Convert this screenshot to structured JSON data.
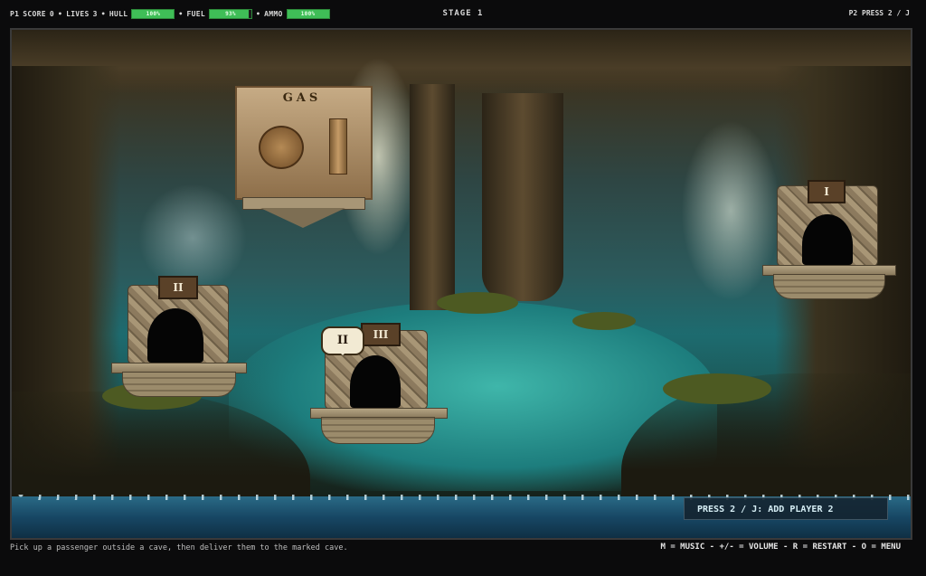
{
  "hud": {
    "p1_label": "P1",
    "score_label": "SCORE",
    "score_value": "0",
    "lives_label": "LIVES",
    "lives_value": "3",
    "hull_label": "HULL",
    "hull_pct": "100%",
    "hull_level": 1.0,
    "fuel_label": "FUEL",
    "fuel_pct": "93%",
    "fuel_level": 0.93,
    "ammo_label": "AMMO",
    "ammo_pct": "100%",
    "ammo_level": 1.0,
    "separator": "•",
    "stage": "STAGE 1",
    "p2_prompt": "P2 PRESS 2 / J",
    "bar_color": "#3fbe57"
  },
  "game": {
    "gas_station_label": "GAS",
    "caves": [
      {
        "label": "I"
      },
      {
        "label": "II"
      },
      {
        "label": "III"
      }
    ],
    "passenger_bubble": "II",
    "add_player_prompt": "PRESS 2 / J: ADD PLAYER 2"
  },
  "footer": {
    "hint": "Pick up a passenger outside a cave, then deliver them to the marked cave.",
    "controls": "M = MUSIC - +/- = VOLUME - R = RESTART - O = MENU"
  }
}
